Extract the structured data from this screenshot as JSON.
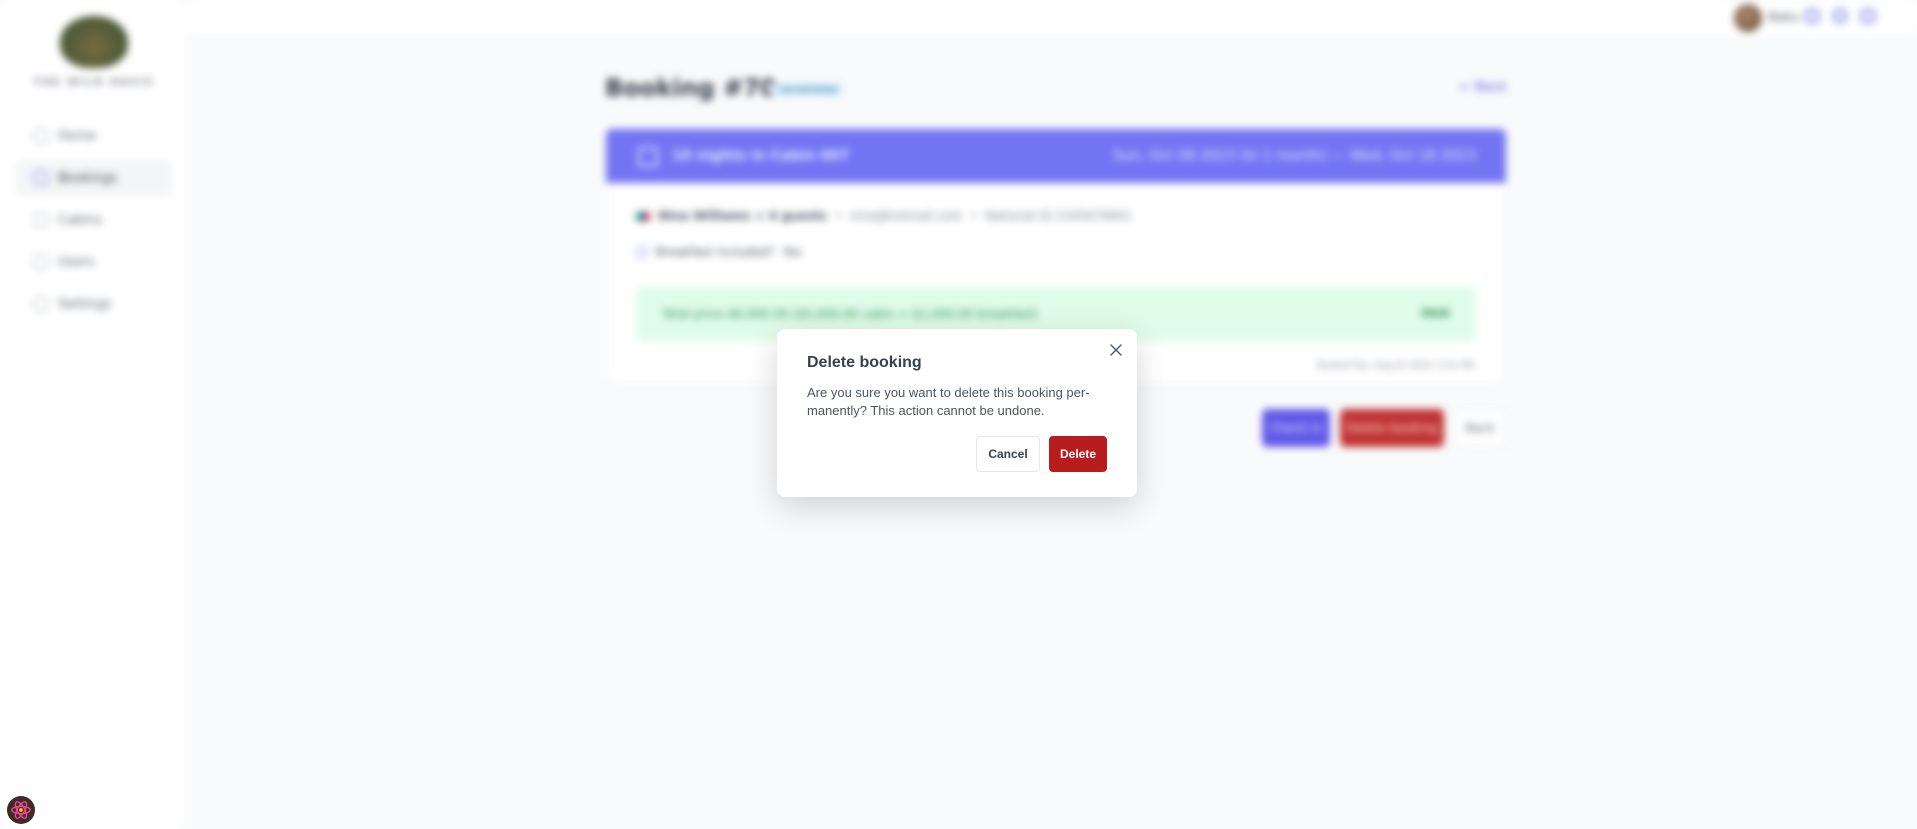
{
  "sidebar": {
    "brand": "THE WILD OASIS",
    "items": [
      {
        "label": "Home",
        "icon": "home-icon"
      },
      {
        "label": "Bookings",
        "icon": "calendar-icon",
        "active": true
      },
      {
        "label": "Cabins",
        "icon": "cabin-icon"
      },
      {
        "label": "Users",
        "icon": "users-icon"
      },
      {
        "label": "Settings",
        "icon": "gear-icon"
      }
    ]
  },
  "header": {
    "user_name": "Babu",
    "icons": [
      "user-icon",
      "moon-icon",
      "logout-icon"
    ]
  },
  "page": {
    "title": "Booking #70",
    "status": "unconfirmed",
    "back_link": "← Back"
  },
  "booking": {
    "summary": "10 nights in Cabin 007",
    "dates": "Sun, Oct 08 2023 (In 1 month) — Wed, Oct 18 2023",
    "guest": "Nina Williams + 6 guests",
    "email": "nina@hotmail.com",
    "national_id": "National ID 2345678901",
    "breakfast_label": "Breakfast included?",
    "breakfast_value": "Yes",
    "total_price": "Total price   $6,000.00 ($5,000.00 cabin + $1,000.00 breakfast)",
    "payment_status": "PAID",
    "booked_at": "Booked Tue, Aug 22 2023, 2:41 PM"
  },
  "actions": {
    "checkin": "Check in",
    "delete": "Delete booking",
    "back": "Back"
  },
  "modal": {
    "title": "Delete booking",
    "text": "Are you sure you want to delete this booking per-manently? This action cannot be undone.",
    "cancel_label": "Cancel",
    "delete_label": "Delete"
  },
  "colors": {
    "accent": "#4f46e5",
    "danger": "#b91c1c",
    "success_bg": "#dcfce7"
  }
}
